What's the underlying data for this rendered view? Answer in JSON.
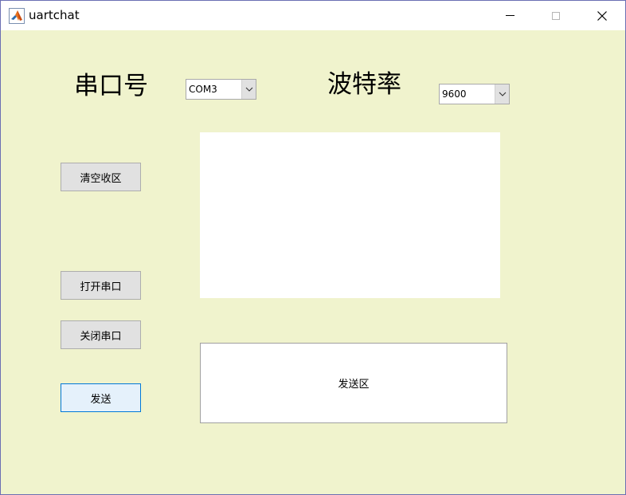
{
  "window": {
    "title": "uartchat"
  },
  "labels": {
    "port": "串口号",
    "baud": "波特率"
  },
  "port_select": {
    "value": "COM3"
  },
  "baud_select": {
    "value": "9600"
  },
  "buttons": {
    "clear_receive": "清空收区",
    "open_port": "打开串口",
    "close_port": "关闭串口",
    "send": "发送"
  },
  "send_area": {
    "text": "发送区"
  },
  "icons": {
    "app": "matlab-icon",
    "minimize": "minimize-icon",
    "maximize": "maximize-icon",
    "close": "close-icon",
    "dropdown": "chevron-down-icon"
  },
  "colors": {
    "background": "#f0f3cd",
    "button": "#e1e1e1",
    "button_focus_border": "#0078d7"
  }
}
